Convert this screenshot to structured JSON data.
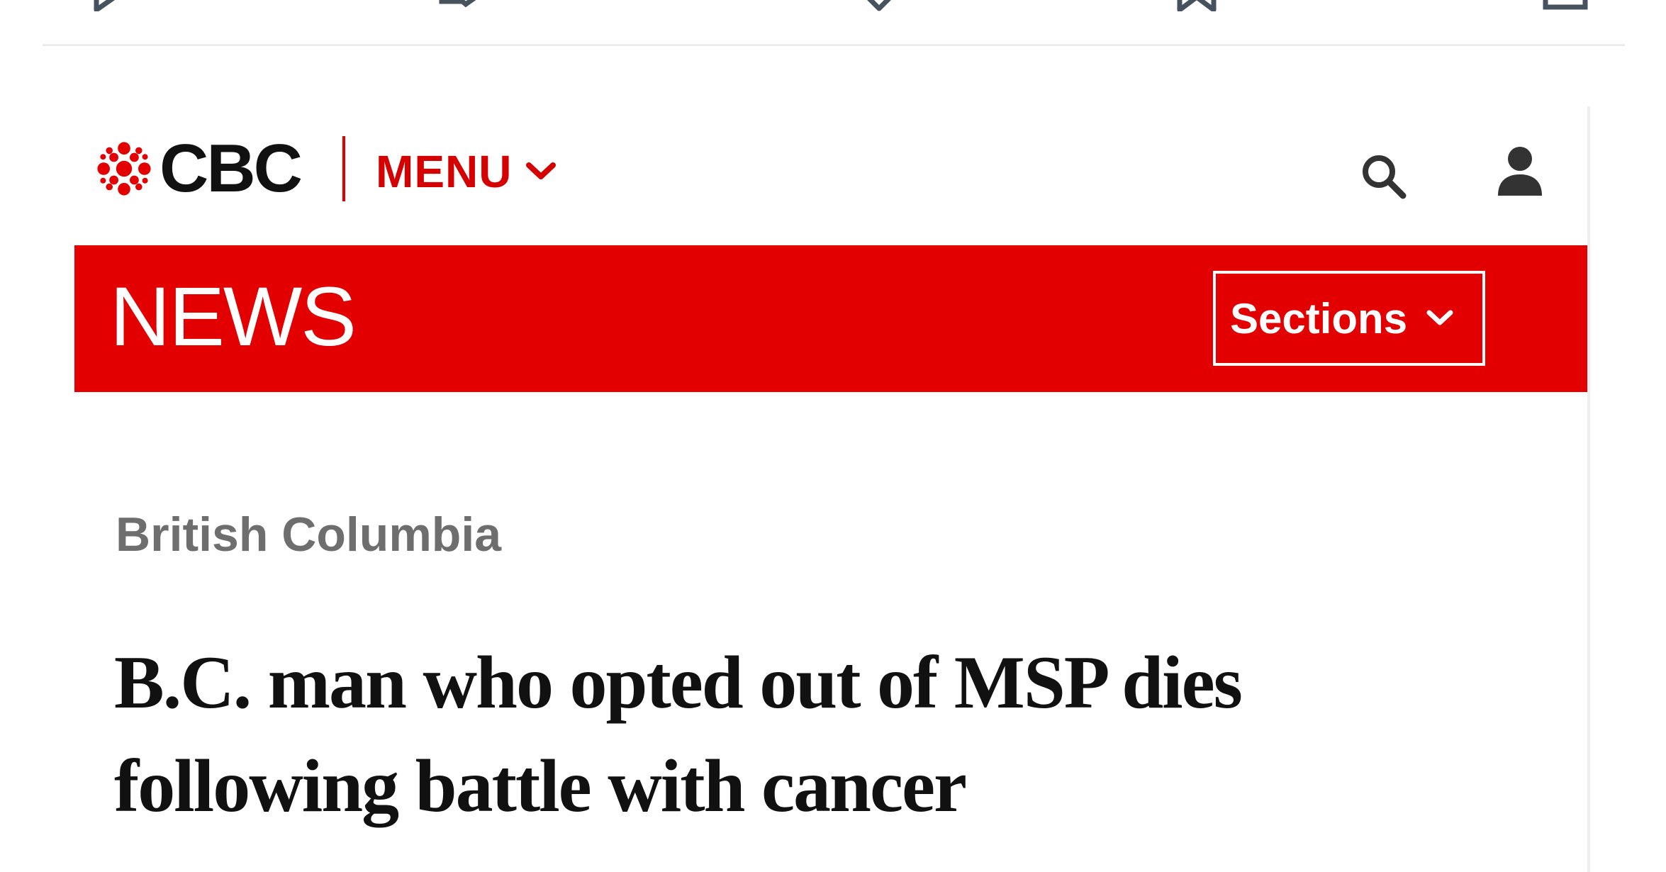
{
  "toolbar": {
    "icons": [
      "play-icon",
      "retweet-icon",
      "heart-icon",
      "bookmark-icon",
      "share-icon"
    ]
  },
  "header": {
    "logo_text": "CBC",
    "menu_label": "MENU",
    "icons": [
      "cbc-gem-icon",
      "chevron-down-icon",
      "search-icon",
      "user-icon"
    ]
  },
  "news_bar": {
    "title": "NEWS",
    "sections_label": "Sections"
  },
  "article": {
    "category": "British Columbia",
    "headline": "B.C. man who opted out of MSP dies following battle with cancer"
  },
  "colors": {
    "brand_red": "#e30000",
    "menu_red": "#d50000",
    "category_gray": "#6e6e6e",
    "text_dark": "#111111",
    "icon_gray": "#46525e"
  }
}
